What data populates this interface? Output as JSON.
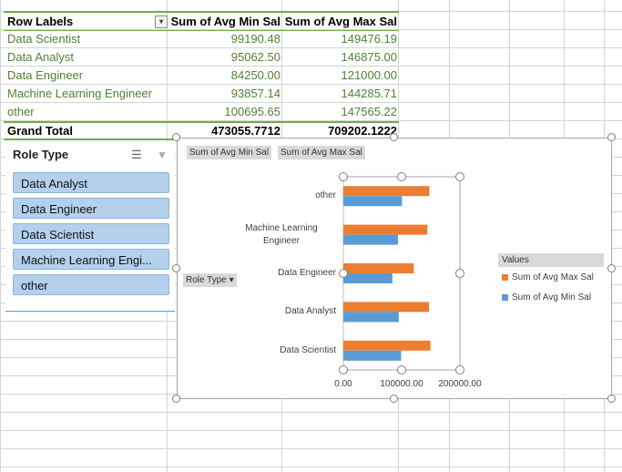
{
  "pivot": {
    "headers": [
      "Row Labels",
      "Sum of Avg Min Sal",
      "Sum of Avg Max Sal"
    ],
    "rows": [
      {
        "label": "Data Scientist",
        "min": "99190.48",
        "max": "149476.19"
      },
      {
        "label": "Data Analyst",
        "min": "95062.50",
        "max": "146875.00"
      },
      {
        "label": "Data Engineer",
        "min": "84250.00",
        "max": "121000.00"
      },
      {
        "label": "Machine Learning Engineer",
        "min": "93857.14",
        "max": "144285.71"
      },
      {
        "label": "other",
        "min": "100695.65",
        "max": "147565.22"
      }
    ],
    "total": {
      "label": "Grand Total",
      "min": "473055.7712",
      "max": "709202.1222"
    }
  },
  "slicer": {
    "title": "Role Type",
    "multi_select_icon": "multi-select-icon",
    "clear_filter_icon": "clear-filter-icon",
    "items": [
      "Data Analyst",
      "Data Engineer",
      "Data Scientist",
      "Machine Learning Engi...",
      "other"
    ]
  },
  "chart_field_buttons": {
    "value1": "Sum of Avg Min Sal",
    "value2": "Sum of Avg Max Sal",
    "axis": "Role Type ▾"
  },
  "chart_data": {
    "type": "bar",
    "orientation": "horizontal",
    "categories": [
      "other",
      "Machine Learning Engineer",
      "Data Engineer",
      "Data Analyst",
      "Data Scientist"
    ],
    "category_labels": [
      [
        "other"
      ],
      [
        "Machine Learning",
        "Engineer"
      ],
      [
        "Data Engineer"
      ],
      [
        "Data Analyst"
      ],
      [
        "Data Scientist"
      ]
    ],
    "series": [
      {
        "name": "Sum of Avg Max Sal",
        "color": "#ed7d31",
        "values": [
          147565.22,
          144285.71,
          121000.0,
          146875.0,
          149476.19
        ]
      },
      {
        "name": "Sum of Avg Min Sal",
        "color": "#5b9bd5",
        "values": [
          100695.65,
          93857.14,
          84250.0,
          95062.5,
          99190.48
        ]
      }
    ],
    "xlim": [
      0,
      200000
    ],
    "tick_labels": [
      "0.00",
      "100000.00",
      "200000.00"
    ],
    "legend_title": "Values",
    "legend_placement": "right"
  }
}
